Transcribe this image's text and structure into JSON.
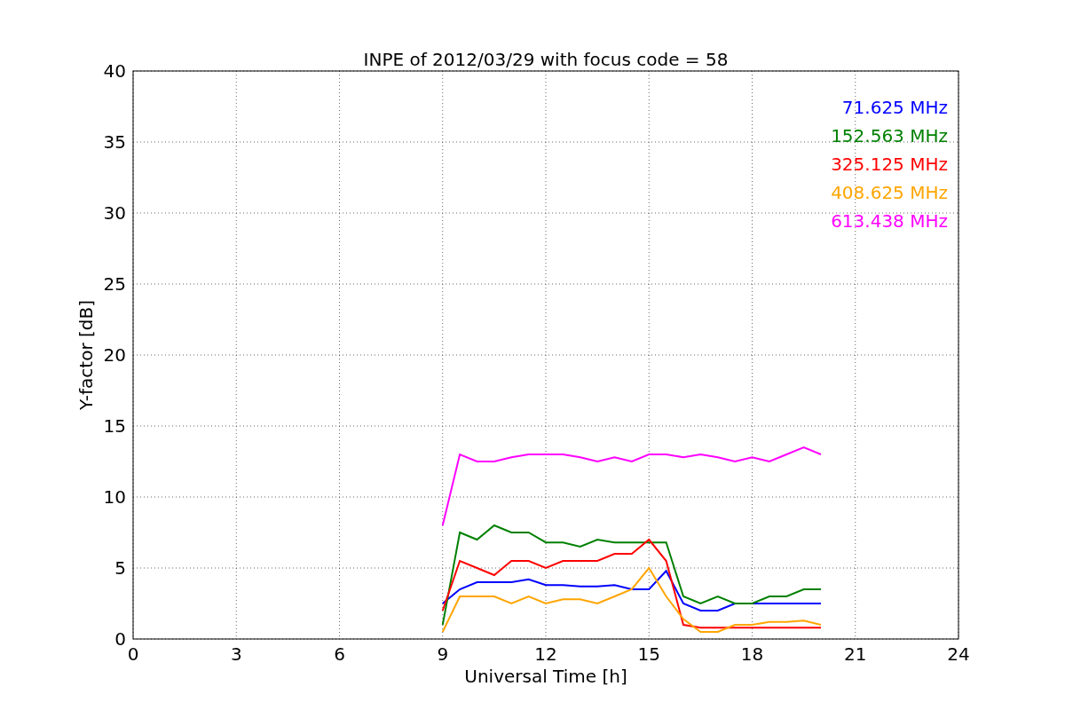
{
  "figure": {
    "chart_data": {
      "type": "line",
      "title": "INPE of 2012/03/29 with focus code = 58",
      "xlabel": "Universal Time [h]",
      "ylabel": "Y-factor [dB]",
      "grid": true,
      "xlim": [
        0,
        24
      ],
      "ylim": [
        0,
        40
      ],
      "xticks": [
        0,
        3,
        6,
        9,
        12,
        15,
        18,
        21,
        24
      ],
      "yticks": [
        0,
        5,
        10,
        15,
        20,
        25,
        30,
        35,
        40
      ],
      "x": [
        9,
        9.5,
        10,
        10.5,
        11,
        11.5,
        12,
        12.5,
        13,
        13.5,
        14,
        14.5,
        15,
        15.5,
        16,
        16.5,
        17,
        17.5,
        18,
        18.5,
        19,
        19.5,
        20
      ],
      "series": [
        {
          "name": "71.625 MHz",
          "color": "#0000ff",
          "values": [
            2.5,
            3.5,
            4,
            4,
            4,
            4.2,
            3.8,
            3.8,
            3.7,
            3.7,
            3.8,
            3.5,
            3.5,
            4.8,
            2.5,
            2,
            2,
            2.5,
            2.5,
            2.5,
            2.5,
            2.5,
            2.5
          ]
        },
        {
          "name": "152.563 MHz",
          "color": "#008000",
          "values": [
            1,
            7.5,
            7,
            8,
            7.5,
            7.5,
            6.8,
            6.8,
            6.5,
            7,
            6.8,
            6.8,
            6.8,
            6.8,
            3,
            2.5,
            3,
            2.5,
            2.5,
            3,
            3,
            3.5,
            3.5
          ]
        },
        {
          "name": "325.125 MHz",
          "color": "#ff0000",
          "values": [
            2,
            5.5,
            5,
            4.5,
            5.5,
            5.5,
            5,
            5.5,
            5.5,
            5.5,
            6,
            6,
            7,
            5.5,
            1,
            0.8,
            0.8,
            0.8,
            0.8,
            0.8,
            0.8,
            0.8,
            0.8
          ]
        },
        {
          "name": "408.625 MHz",
          "color": "#ffa500",
          "values": [
            0.5,
            3,
            3,
            3,
            2.5,
            3,
            2.5,
            2.8,
            2.8,
            2.5,
            3,
            3.5,
            5,
            3,
            1.4,
            0.5,
            0.5,
            1,
            1,
            1.2,
            1.2,
            1.3,
            1
          ]
        },
        {
          "name": "613.438 MHz",
          "color": "#ff00ff",
          "values": [
            8,
            13,
            12.5,
            12.5,
            12.8,
            13,
            13,
            13,
            12.8,
            12.5,
            12.8,
            12.5,
            13,
            13,
            12.8,
            13,
            12.8,
            12.5,
            12.8,
            12.5,
            13,
            13.5,
            13
          ]
        }
      ]
    }
  }
}
